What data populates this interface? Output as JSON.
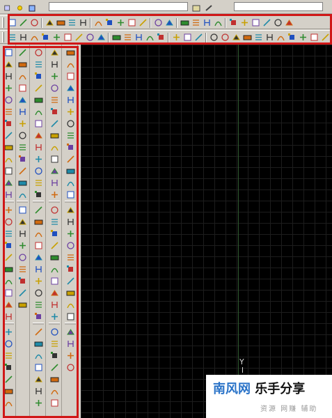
{
  "topstrip": {
    "icons": [
      "layer-icon",
      "sun-icon",
      "layer-state-icon"
    ]
  },
  "toolbar_standard": {
    "buttons": [
      "new-file-icon",
      "open-file-icon",
      "save-icon",
      "print-icon",
      "print-preview-icon",
      "publish-icon",
      "3d-publish-icon",
      "cut-icon",
      "copy-icon",
      "paste-icon",
      "match-properties-icon",
      "block-editor-icon",
      "undo-icon",
      "redo-icon",
      "pan-icon",
      "zoom-realtime-icon",
      "zoom-window-icon",
      "zoom-previous-icon",
      "properties-icon",
      "design-center-icon",
      "tool-palettes-icon",
      "sheet-set-icon",
      "markup-icon",
      "calculator-icon"
    ]
  },
  "toolbar_dimension": {
    "buttons": [
      "linear-dimension-icon",
      "aligned-dimension-icon",
      "arc-length-icon",
      "ordinate-icon",
      "radius-icon",
      "jogged-icon",
      "diameter-icon",
      "angular-icon",
      "quick-dimension-icon",
      "baseline-icon",
      "continue-icon",
      "quick-leader-icon",
      "tolerance-icon",
      "center-mark-icon",
      "dimension-edit-icon",
      "dimension-text-edit-icon",
      "dimension-update-icon",
      "dimension-style-icon"
    ]
  },
  "canvas": {
    "ucs_y_label": "Y",
    "background": "#000000",
    "grid_color": "#1d1d1d",
    "axis_color": "#2e5a2e"
  },
  "watermark": {
    "brand": "南风网",
    "slogan": "乐手分享",
    "subtitle": "资源 网赚 辅助",
    "brand_color": "#2a73c8"
  },
  "highlight_color": "#d01717"
}
